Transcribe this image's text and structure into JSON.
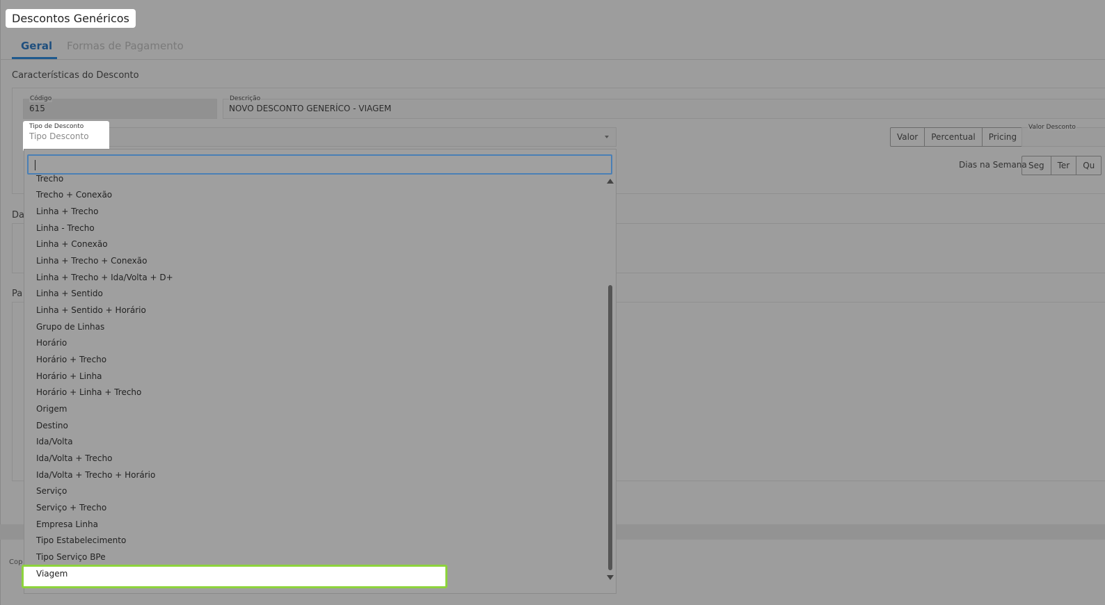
{
  "header": {
    "title": "Descontos Genéricos"
  },
  "tabs": [
    {
      "label": "Geral",
      "active": true
    },
    {
      "label": "Formas de Pagamento",
      "active": false
    }
  ],
  "sections": {
    "caracteristicas": "Características do Desconto",
    "second_partial": "Da",
    "third_partial": "Pa"
  },
  "fields": {
    "codigo": {
      "label": "Código",
      "value": "615"
    },
    "descricao": {
      "label": "Descrição",
      "value": "NOVO DESCONTO GENERÍCO  - VIAGEM"
    },
    "tipo_desconto": {
      "label": "Tipo de Desconto",
      "placeholder": "Tipo Desconto"
    },
    "valor_desconto": {
      "label": "Valor Desconto"
    }
  },
  "value_type_buttons": [
    "Valor",
    "Percentual",
    "Pricing"
  ],
  "days": {
    "label": "Dias na Semana",
    "buttons": [
      "Seg",
      "Ter",
      "Qu"
    ]
  },
  "dropdown": {
    "search_value": "",
    "options": [
      "Trecho",
      "Trecho + Conexão",
      "Linha + Trecho",
      "Linha - Trecho",
      "Linha + Conexão",
      "Linha + Trecho + Conexão",
      "Linha + Trecho + Ida/Volta + D+",
      "Linha + Sentido",
      "Linha + Sentido + Horário",
      "Grupo de Linhas",
      "Horário",
      "Horário + Trecho",
      "Horário + Linha",
      "Horário + Linha + Trecho",
      "Origem",
      "Destino",
      "Ida/Volta",
      "Ida/Volta + Trecho",
      "Ida/Volta + Trecho + Horário",
      "Serviço",
      "Serviço + Trecho",
      "Empresa Linha",
      "Tipo Estabelecimento",
      "Tipo Serviço BPe",
      "Viagem"
    ],
    "selected": "Viagem"
  },
  "footer": {
    "text": "Cop"
  },
  "colors": {
    "accent": "#1f5a8e",
    "highlight": "#8dd33c",
    "overlay": "#9d9d9d"
  }
}
